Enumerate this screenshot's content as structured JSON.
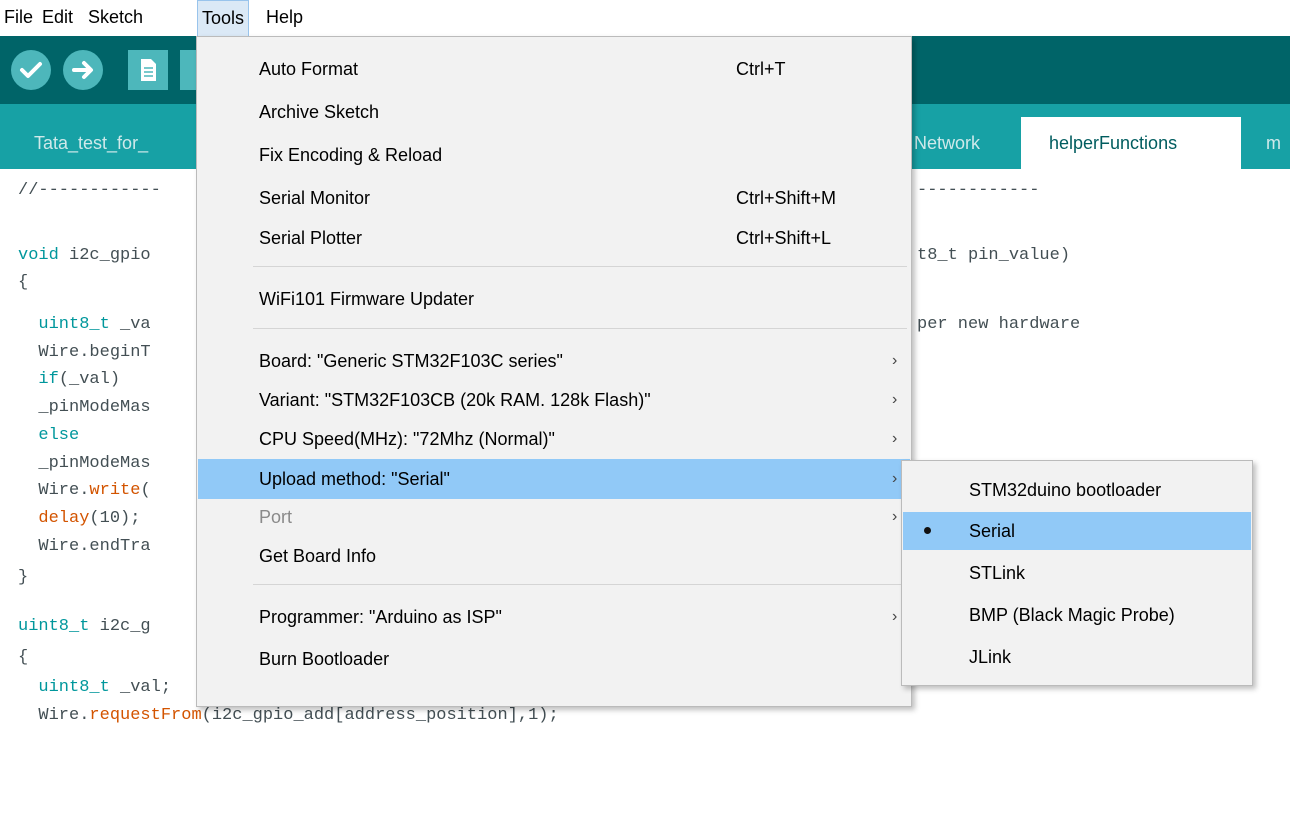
{
  "menubar": {
    "file": "File",
    "edit": "Edit",
    "sketch": "Sketch",
    "tools": "Tools",
    "help": "Help"
  },
  "toolbar": {
    "verify_icon": "checkmark-icon",
    "upload_icon": "arrow-right-icon",
    "new_icon": "file-icon"
  },
  "tabs": {
    "left": "Tata_test_for_",
    "network": "Network",
    "helper": "helperFunctions",
    "right_partial": "m"
  },
  "code": {
    "l1": "//------------",
    "l1b": "------------",
    "l2a": "void",
    "l2b": " i2c_gpio",
    "l2c": "t8_t pin_value)",
    "l3": "{",
    "l4a": "  uint8_t",
    "l4b": " _va",
    "l4c": "per new hardware",
    "l5": "  Wire.beginT",
    "l6a": "  if",
    "l6b": "(_val)",
    "l7": "  _pinModeMas",
    "l8": "  else",
    "l9": "  _pinModeMas",
    "l10a": "  Wire.",
    "l10b": "write",
    "l10c": "(",
    "l11a": "  delay",
    "l11b": "(10);",
    "l12": "  Wire.endTra",
    "l13": "}",
    "l14a": "uint8_t",
    "l14b": " i2c_g",
    "l15": "{",
    "l16a": "  uint8_t",
    "l16b": " _val;",
    "l17a": "  Wire.",
    "l17b": "requestFrom",
    "l17c": "(i2c_gpio_add[address_position],1);"
  },
  "tools_menu": {
    "auto_format": {
      "label": "Auto Format",
      "shortcut": "Ctrl+T"
    },
    "archive_sketch": {
      "label": "Archive Sketch"
    },
    "fix_encoding": {
      "label": "Fix Encoding & Reload"
    },
    "serial_monitor": {
      "label": "Serial Monitor",
      "shortcut": "Ctrl+Shift+M"
    },
    "serial_plotter": {
      "label": "Serial Plotter",
      "shortcut": "Ctrl+Shift+L"
    },
    "wifi_updater": {
      "label": "WiFi101 Firmware Updater"
    },
    "board": {
      "label": "Board: \"Generic STM32F103C series\""
    },
    "variant": {
      "label": "Variant: \"STM32F103CB (20k RAM. 128k Flash)\""
    },
    "cpu_speed": {
      "label": "CPU Speed(MHz): \"72Mhz (Normal)\""
    },
    "upload_method": {
      "label": "Upload method: \"Serial\""
    },
    "port": {
      "label": "Port"
    },
    "board_info": {
      "label": "Get Board Info"
    },
    "programmer": {
      "label": "Programmer: \"Arduino as ISP\""
    },
    "burn_bootloader": {
      "label": "Burn Bootloader"
    },
    "arrow": "›"
  },
  "upload_submenu": {
    "items": [
      "STM32duino bootloader",
      "Serial",
      "STLink",
      "BMP (Black Magic Probe)",
      "JLink"
    ],
    "selected": "Serial"
  },
  "colors": {
    "toolbar": "#006468",
    "tabbar": "#17a1a5",
    "button": "#4db7bb",
    "highlight": "#91c9f7"
  }
}
